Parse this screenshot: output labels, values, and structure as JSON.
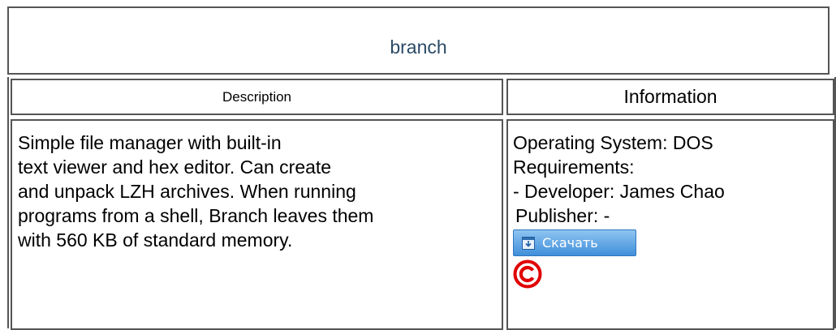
{
  "title": "branch",
  "headers": {
    "description": "Description",
    "information": "Information"
  },
  "description_lines": [
    "Simple file manager with built-in",
    "text viewer and hex editor. Can create",
    "and unpack LZH archives. When running",
    "programs from a shell, Branch leaves them",
    "with 560 KB of standard memory."
  ],
  "information": {
    "os": "Operating System: DOS",
    "requirements": "Requirements:",
    "developer": "- Developer: James Chao",
    "publisher": "Publisher: -",
    "download_label": "Скачать"
  },
  "icons": {
    "download": "download-icon",
    "copyright": "copyright-icon"
  },
  "colors": {
    "title_text": "#2a4a66",
    "button_top": "#8fc4f2",
    "button_bottom": "#3f8fda",
    "copyright": "#e00000"
  }
}
